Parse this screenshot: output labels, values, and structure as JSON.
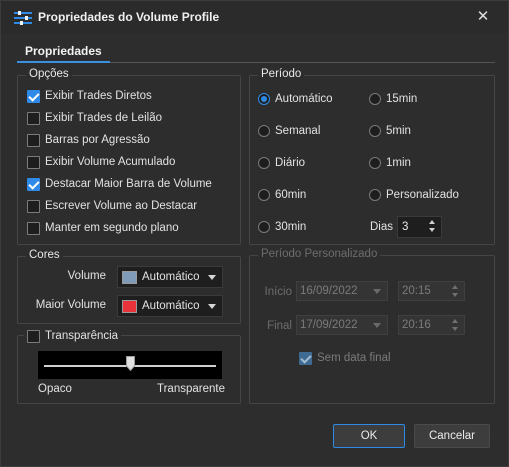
{
  "window": {
    "title": "Propriedades do Volume Profile"
  },
  "tabs": [
    {
      "label": "Propriedades"
    }
  ],
  "opcoes": {
    "title": "Opções",
    "items": [
      {
        "label": "Exibir Trades Diretos",
        "checked": true
      },
      {
        "label": "Exibir Trades de Leilão",
        "checked": false
      },
      {
        "label": "Barras por Agressão",
        "checked": false
      },
      {
        "label": "Exibir Volume Acumulado",
        "checked": false
      },
      {
        "label": "Destacar Maior Barra de Volume",
        "checked": true
      },
      {
        "label": "Escrever Volume ao Destacar",
        "checked": false
      },
      {
        "label": "Manter em segundo plano",
        "checked": false
      }
    ]
  },
  "cores": {
    "title": "Cores",
    "volume_label": "Volume",
    "volume_value": "Automático",
    "volume_color": "#7f9bb8",
    "maior_label": "Maior Volume",
    "maior_value": "Automático",
    "maior_color": "#e8333a"
  },
  "transparencia": {
    "label": "Transparência",
    "checked": false,
    "slider_value": 0.5,
    "min_label": "Opaco",
    "max_label": "Transparente"
  },
  "periodo": {
    "title": "Período",
    "options": [
      {
        "label": "Automático",
        "checked": true
      },
      {
        "label": "15min",
        "checked": false
      },
      {
        "label": "Semanal",
        "checked": false
      },
      {
        "label": "5min",
        "checked": false
      },
      {
        "label": "Diário",
        "checked": false
      },
      {
        "label": "1min",
        "checked": false
      },
      {
        "label": "60min",
        "checked": false
      },
      {
        "label": "Personalizado",
        "checked": false
      },
      {
        "label": "30min",
        "checked": false
      }
    ],
    "dias_label": "Dias",
    "dias_value": "3"
  },
  "personalizado": {
    "title": "Período Personalizado",
    "inicio_label": "Início",
    "inicio_date": "16/09/2022",
    "inicio_time": "20:15",
    "final_label": "Final",
    "final_date": "17/09/2022",
    "final_time": "20:16",
    "sem_data_final": "Sem data final"
  },
  "buttons": {
    "ok": "OK",
    "cancel": "Cancelar"
  },
  "colors": {
    "accent": "#2e8ae6",
    "background": "#2d2d2d"
  }
}
